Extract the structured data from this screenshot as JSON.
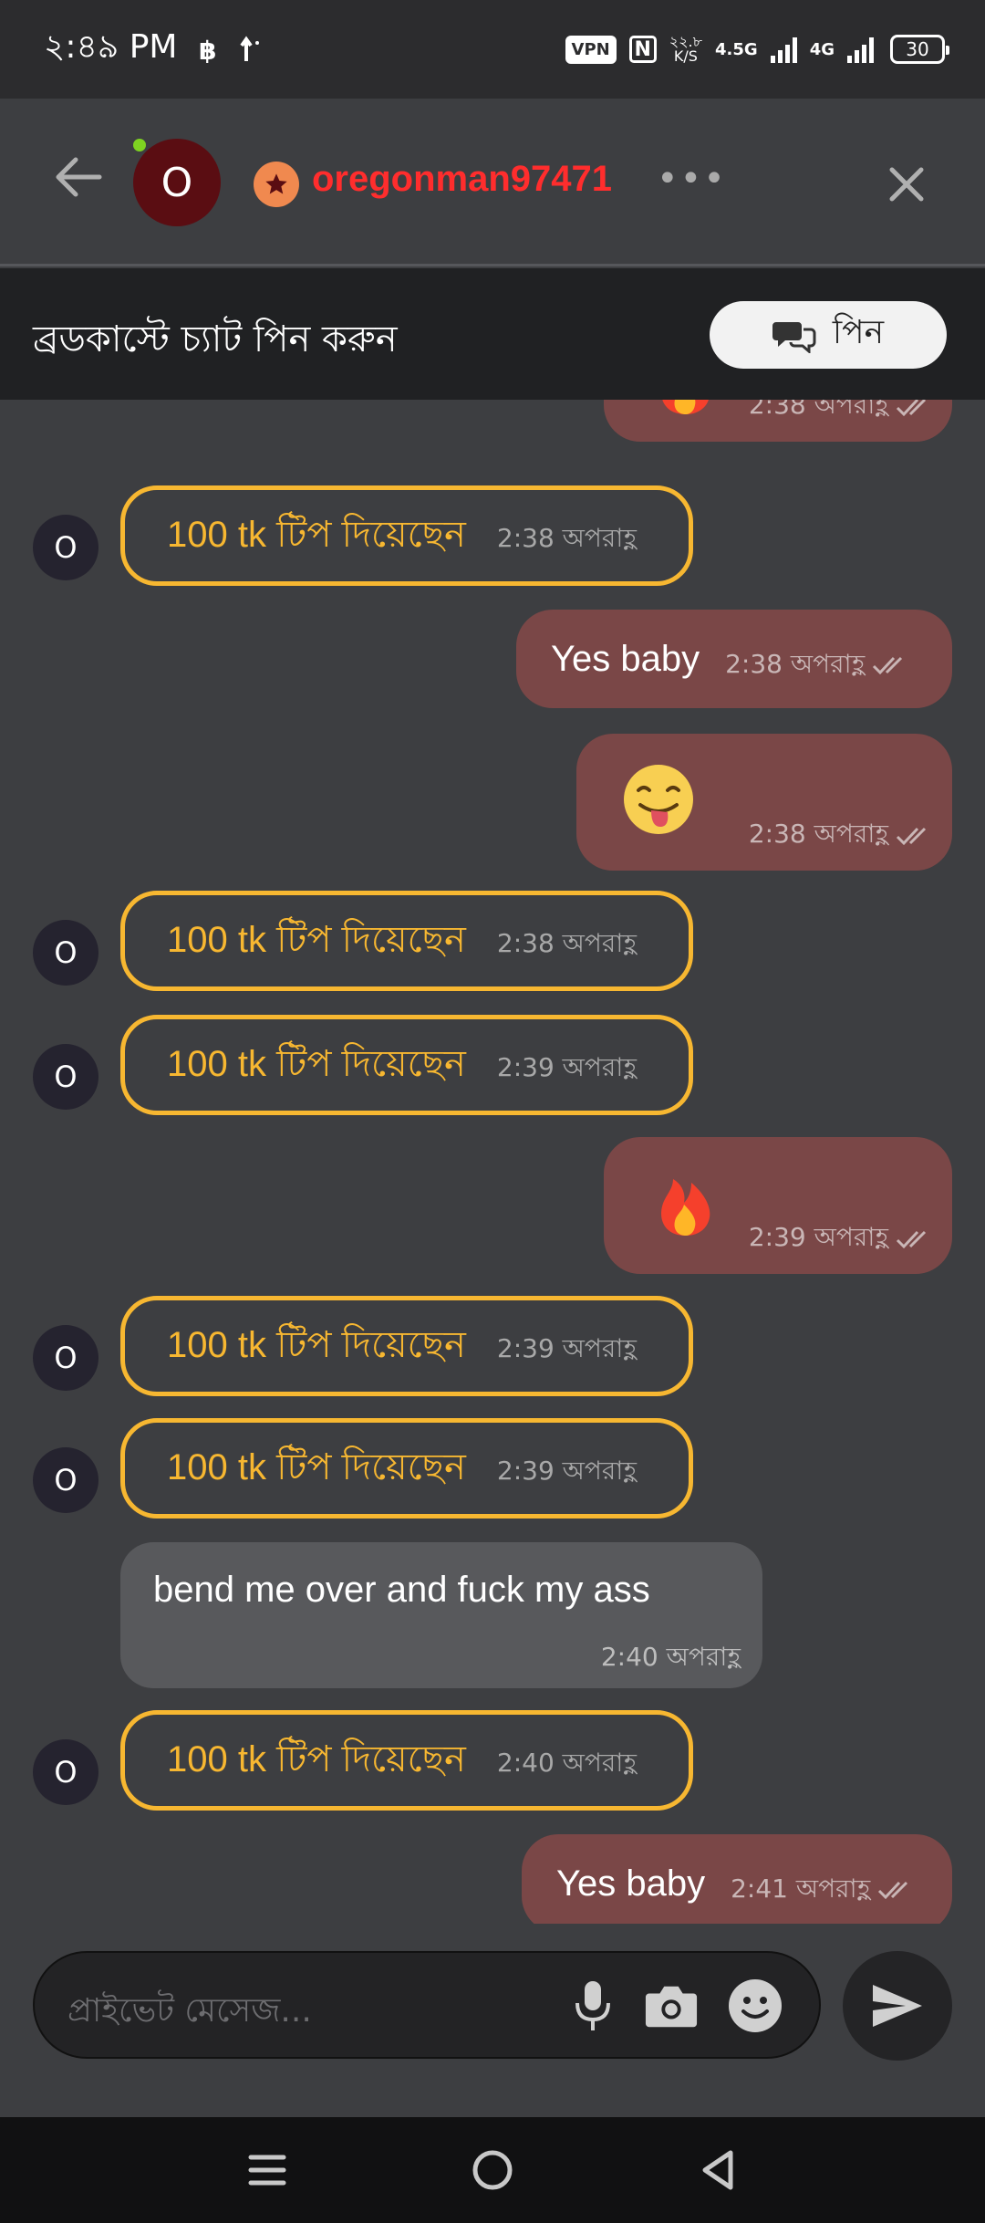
{
  "status_bar": {
    "time": "২:৪৯ PM",
    "left_icons": [
      "bitcoin-icon",
      "upload-arrow-icon"
    ],
    "vpn": "VPN",
    "nfc": "N",
    "net_speed_value": "২২.৮",
    "net_speed_unit": "K/S",
    "network_1": "4.5G",
    "network_2": "4G",
    "battery": "30"
  },
  "header": {
    "avatar_letter": "O",
    "username": "oregonman97471",
    "username_color": "#ff2d2d",
    "more_label": "•••",
    "online": true
  },
  "pin_bar": {
    "text": "ব্রডকাস্টে চ্যাট পিন করুন",
    "button_label": "পিন"
  },
  "messages": [
    {
      "kind": "sent_emoji",
      "emoji": "fire",
      "time": "2:38 অপরাহ্ণ"
    },
    {
      "kind": "tip",
      "avatar": "O",
      "text": "100 tk টিপ দিয়েছেন",
      "time": "2:38 অপরাহ্ণ"
    },
    {
      "kind": "sent_text",
      "text": "Yes baby",
      "time": "2:38 অপরাহ্ণ"
    },
    {
      "kind": "sent_emoji",
      "emoji": "tongue-face",
      "time": "2:38 অপরাহ্ণ"
    },
    {
      "kind": "tip",
      "avatar": "O",
      "text": "100 tk টিপ দিয়েছেন",
      "time": "2:38 অপরাহ্ণ"
    },
    {
      "kind": "tip",
      "avatar": "O",
      "text": "100 tk টিপ দিয়েছেন",
      "time": "2:39 অপরাহ্ণ"
    },
    {
      "kind": "sent_emoji",
      "emoji": "fire",
      "time": "2:39 অপরাহ্ণ"
    },
    {
      "kind": "tip",
      "avatar": "O",
      "text": "100 tk টিপ দিয়েছেন",
      "time": "2:39 অপরাহ্ণ"
    },
    {
      "kind": "tip",
      "avatar": "O",
      "text": "100 tk টিপ দিয়েছেন",
      "time": "2:39 অপরাহ্ণ"
    },
    {
      "kind": "received_text",
      "text": "bend me over and fuck my ass",
      "time": "2:40 অপরাহ্ণ"
    },
    {
      "kind": "tip",
      "avatar": "O",
      "text": "100 tk টিপ দিয়েছেন",
      "time": "2:40 অপরাহ্ণ"
    },
    {
      "kind": "sent_text",
      "text": "Yes baby",
      "time": "2:41 অপরাহ্ণ"
    }
  ],
  "composer": {
    "placeholder": "প্রাইভেট মেসেজ..."
  },
  "colors": {
    "background": "#3d3e41",
    "sent_bubble": "#7a4747",
    "received_bubble": "#58595c",
    "tip_accent": "#f7b731"
  }
}
